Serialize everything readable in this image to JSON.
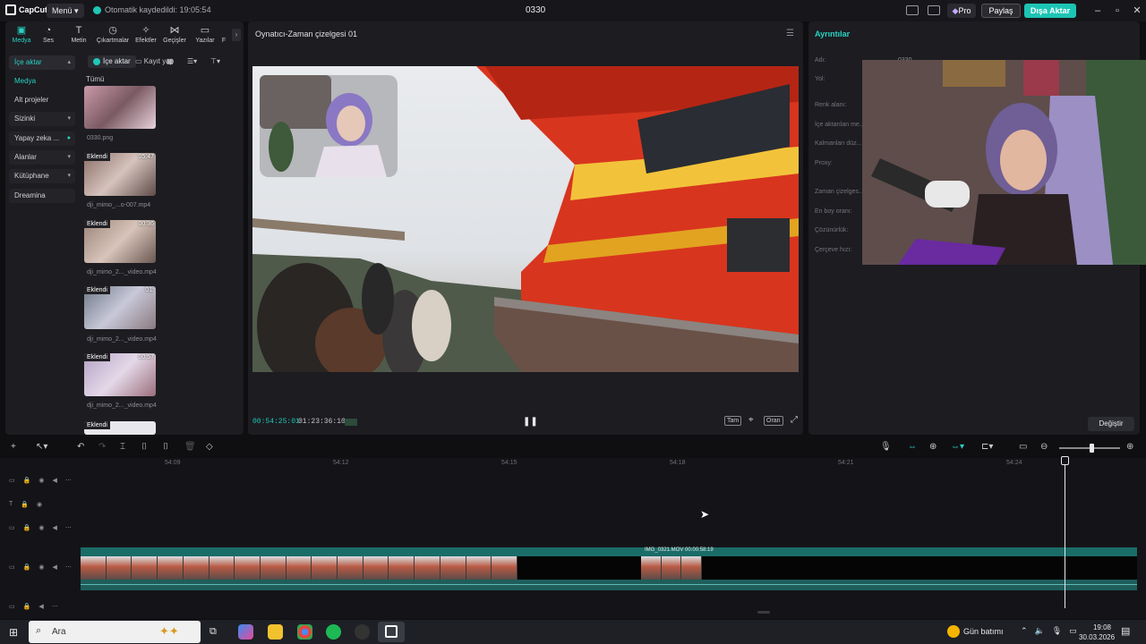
{
  "titlebar": {
    "app_name": "CapCut",
    "menu_label": "Menü",
    "autosave_text": "Otomatik kaydedildi: 19:05:54",
    "project_title": "0330",
    "pro_label": "Pro",
    "share_label": "Paylaş",
    "export_label": "Dışa Aktar"
  },
  "tools": [
    {
      "label": "Medya",
      "icon": "media-icon"
    },
    {
      "label": "Ses",
      "icon": "audio-icon"
    },
    {
      "label": "Metin",
      "icon": "text-icon"
    },
    {
      "label": "Çıkartmalar",
      "icon": "sticker-icon"
    },
    {
      "label": "Efektler",
      "icon": "effects-icon"
    },
    {
      "label": "Geçişler",
      "icon": "transition-icon"
    },
    {
      "label": "Yazılar",
      "icon": "captions-icon"
    },
    {
      "label": "F",
      "icon": "filter-icon"
    }
  ],
  "sidebar": [
    {
      "label": "İçe aktar",
      "active": true
    },
    {
      "label": "Medya",
      "active": false
    },
    {
      "label": "Alt projeler",
      "active": false
    },
    {
      "label": "Sizinki",
      "active": false
    },
    {
      "label": "Yapay zeka ...",
      "active": false
    },
    {
      "label": "Alanlar",
      "active": false
    },
    {
      "label": "Kütüphane",
      "active": false
    },
    {
      "label": "Dreamina",
      "active": false
    }
  ],
  "media": {
    "import_label": "İçe aktar",
    "record_label": "Kayıt yap",
    "all_label": "Tümü",
    "items": [
      {
        "name": "0330.png",
        "badge": "",
        "duration": ""
      },
      {
        "name": "dji_mimo_...o-007.mp4",
        "badge": "Eklendi",
        "duration": "05:47"
      },
      {
        "name": "dji_mimo_2..._video.mp4",
        "badge": "Eklendi",
        "duration": "00:36"
      },
      {
        "name": "dji_mimo_2..._video.mp4",
        "badge": "Eklendi",
        "duration": "01:"
      },
      {
        "name": "dji_mimo_2..._video.mp4",
        "badge": "Eklendi",
        "duration": "00:57"
      },
      {
        "name": "",
        "badge": "Eklendi",
        "duration": ""
      }
    ]
  },
  "player": {
    "title": "Oynatıcı-Zaman çizelgesi 01",
    "current_time": "00:54:25:01",
    "total_time": "01:23:36:10",
    "full_label": "Tam",
    "ratio_label": "Oran"
  },
  "details": {
    "title": "Ayrıntılar",
    "labels": [
      "Adı:",
      "Yol:",
      "Renk alanı:",
      "İçe aktarılan me...",
      "Kalmanları düz...",
      "Proxy:",
      "Zaman çizelges...",
      "En boy oranı:",
      "Çözünürlük:",
      "Çerçeve hızı:"
    ],
    "name_value": "0330",
    "change_label": "Değiştir"
  },
  "timeline": {
    "ruler": [
      "54:09",
      "54:12",
      "54:15",
      "54:18",
      "54:21",
      "54:24"
    ],
    "clip_label": "IMG_0321.MOV",
    "clip_duration": "00:00:58:19"
  },
  "taskbar": {
    "search_placeholder": "Ara",
    "weather": "Gün batımı",
    "time": "19:08",
    "date": "30.03.2026"
  },
  "colors": {
    "accent": "#1fc7b6",
    "export_bg": "#1cc4b4",
    "panel_bg": "#1c1c21"
  }
}
